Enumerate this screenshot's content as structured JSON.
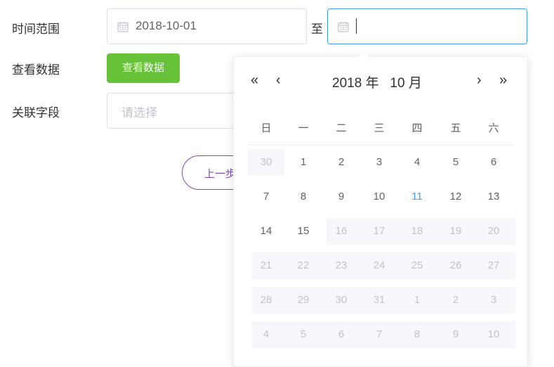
{
  "form": {
    "time_range_label": "时间范围",
    "view_data_label": "查看数据",
    "related_field_label": "关联字段",
    "start_date": "2018-10-01",
    "range_separator": "至",
    "view_data_button": "查看数据",
    "related_field_placeholder": "请选择",
    "prev_button": "上一步"
  },
  "datepicker": {
    "year": "2018",
    "year_suffix": "年",
    "month": "10",
    "month_suffix": "月",
    "nav": {
      "prev_year": "«",
      "prev_month": "‹",
      "next_month": "›",
      "next_year": "»"
    },
    "weekdays": [
      "日",
      "一",
      "二",
      "三",
      "四",
      "五",
      "六"
    ],
    "weeks": [
      [
        "30",
        "1",
        "2",
        "3",
        "4",
        "5",
        "6"
      ],
      [
        "7",
        "8",
        "9",
        "10",
        "11",
        "12",
        "13"
      ],
      [
        "14",
        "15",
        "16",
        "17",
        "18",
        "19",
        "20"
      ],
      [
        "21",
        "22",
        "23",
        "24",
        "25",
        "26",
        "27"
      ],
      [
        "28",
        "29",
        "30",
        "31",
        "1",
        "2",
        "3"
      ],
      [
        "4",
        "5",
        "6",
        "7",
        "8",
        "9",
        "10"
      ]
    ],
    "today": "11",
    "colors": {
      "today": "#409eff",
      "disabled_bg": "#f5f7fa",
      "disabled_text": "#c0c4cc"
    }
  }
}
